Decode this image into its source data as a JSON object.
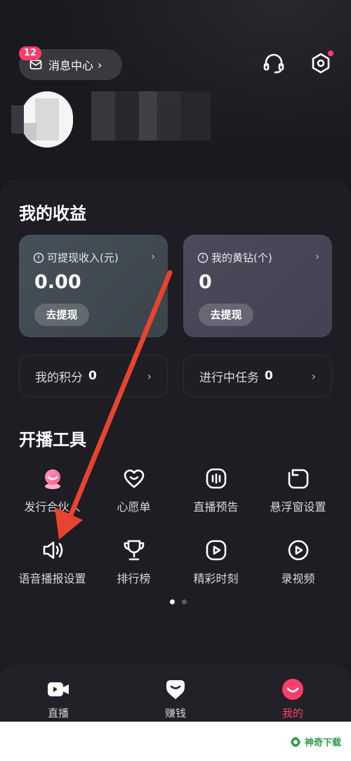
{
  "header": {
    "message_center_label": "消息中心",
    "message_badge": "12",
    "chevron": "›",
    "icons": [
      "headset-icon",
      "settings-icon"
    ]
  },
  "earnings": {
    "title": "我的收益",
    "withdrawable": {
      "label": "可提现收入(元)",
      "value": "0.00",
      "button": "去提现"
    },
    "diamonds": {
      "label": "我的黄钻(个)",
      "value": "0",
      "button": "去提现"
    },
    "points": {
      "label": "我的积分",
      "value": "0"
    },
    "tasks": {
      "label": "进行中任务",
      "value": "0"
    }
  },
  "tools": {
    "title": "开播工具",
    "items": [
      {
        "label": "发行合伙人",
        "icon": "partner-avatar-icon"
      },
      {
        "label": "心愿单",
        "icon": "heart-wishlist-icon"
      },
      {
        "label": "直播预告",
        "icon": "live-preview-icon"
      },
      {
        "label": "悬浮窗设置",
        "icon": "floating-window-icon"
      },
      {
        "label": "语音播报设置",
        "icon": "speaker-icon"
      },
      {
        "label": "排行榜",
        "icon": "trophy-icon"
      },
      {
        "label": "精彩时刻",
        "icon": "highlight-play-icon"
      },
      {
        "label": "录视频",
        "icon": "record-video-icon"
      }
    ],
    "pager": {
      "pages": 2,
      "current": 1
    }
  },
  "bottom_nav": {
    "items": [
      {
        "label": "直播",
        "icon": "live-camera-icon"
      },
      {
        "label": "赚钱",
        "icon": "earn-money-icon"
      },
      {
        "label": "我的",
        "icon": "profile-smile-icon"
      }
    ],
    "active": "我的"
  },
  "watermark": {
    "text": "神奇下载"
  },
  "colors": {
    "accent": "#ff3d6b",
    "background": "#1e1d23",
    "annotation_arrow": "#e8432f"
  }
}
